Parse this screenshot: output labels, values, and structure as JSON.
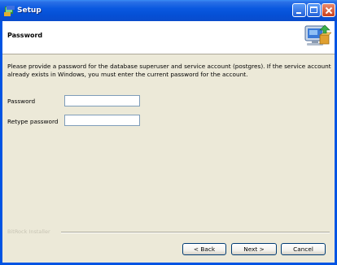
{
  "window": {
    "title": "Setup"
  },
  "header": {
    "title": "Password"
  },
  "description": "Please provide a password for the database superuser and service account (postgres). If the service account already exists in Windows, you must enter the current password for the account.",
  "form": {
    "password_label": "Password",
    "password_value": "",
    "retype_label": "Retype password",
    "retype_value": ""
  },
  "footer": {
    "installer_label": "BitRock Installer"
  },
  "buttons": {
    "back": "< Back",
    "next": "Next >",
    "cancel": "Cancel"
  },
  "icons": {
    "app": "setup-app-icon",
    "header": "computer-install-icon"
  },
  "colors": {
    "titlebar": "#0a58e0",
    "client": "#ece9d8",
    "header_bg": "#ffffff"
  }
}
